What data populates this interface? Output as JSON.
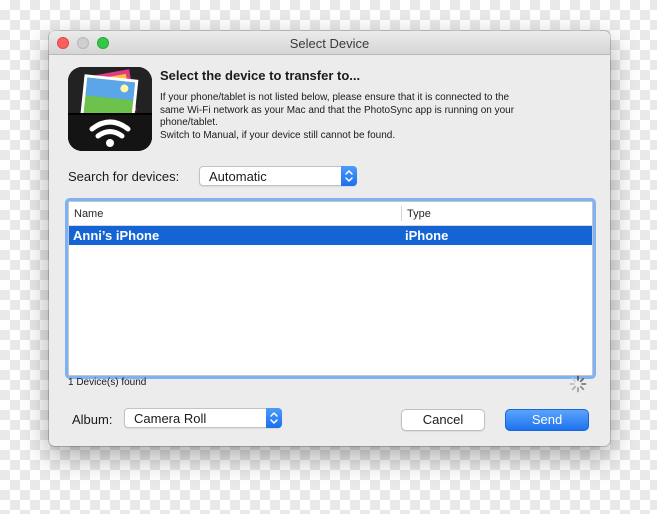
{
  "window": {
    "title": "Select Device"
  },
  "header": {
    "heading": "Select the device to transfer to...",
    "description_lines": [
      "If your phone/tablet is not listed below, please ensure that it is connected to the",
      "same Wi-Fi network as your Mac and that the PhotoSync app is running on your",
      "phone/tablet.",
      "Switch to Manual, if your device still cannot be found."
    ]
  },
  "search": {
    "label": "Search for devices:",
    "selected": "Automatic"
  },
  "device_table": {
    "columns": [
      "Name",
      "Type"
    ],
    "rows": [
      {
        "name": "Anni’s iPhone",
        "type": "iPhone",
        "selected": true
      }
    ]
  },
  "status": {
    "found_text": "1 Device(s) found"
  },
  "album": {
    "label": "Album:",
    "selected": "Camera Roll"
  },
  "buttons": {
    "cancel": "Cancel",
    "send": "Send"
  },
  "colors": {
    "selection": "#1464d6",
    "accent": "#1d72ef",
    "focus_ring": "#7fb1f5",
    "window_bg": "#ececec"
  },
  "icons": {
    "app": "photosync-wifi-icon",
    "popup_arrows": "chevron-up-down-icon",
    "loading": "spinner-icon"
  }
}
